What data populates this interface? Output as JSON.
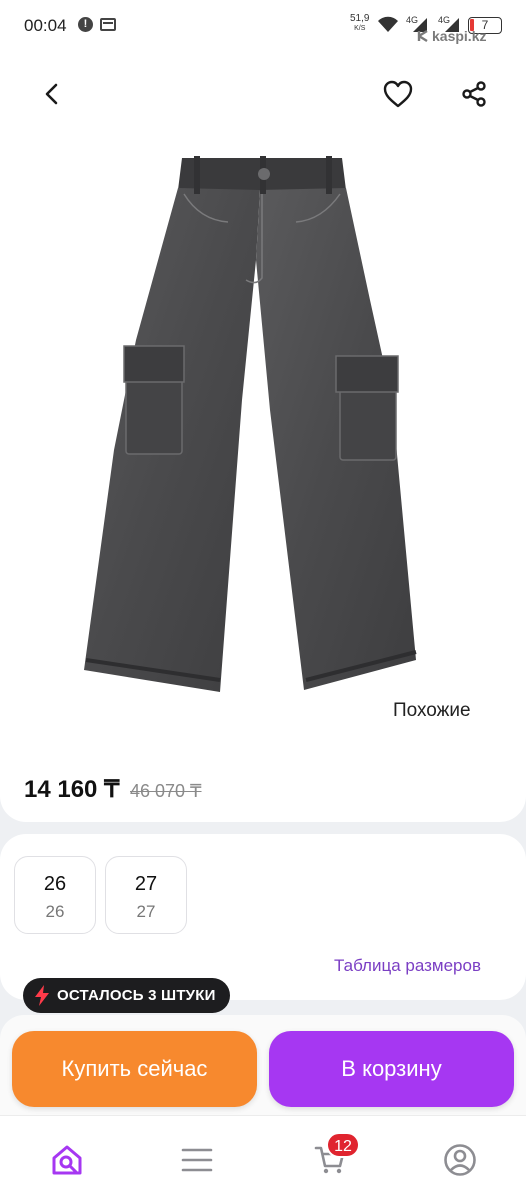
{
  "status_bar": {
    "time": "00:04",
    "speed_value": "51,9",
    "speed_unit": "K/S",
    "network_1": "4G",
    "network_2": "4G",
    "battery": "7",
    "watermark": "kaspi.kz"
  },
  "product": {
    "similar_label": "Похожие",
    "price_current": "14 160 ₸",
    "price_old": "46 070 ₸"
  },
  "sizes": [
    {
      "main": "26",
      "sub": "26"
    },
    {
      "main": "27",
      "sub": "27"
    }
  ],
  "size_table_label": "Таблица размеров",
  "stock_label": "ОСТАЛОСЬ 3 ШТУКИ",
  "actions": {
    "buy_now": "Купить сейчас",
    "to_cart": "В корзину"
  },
  "tabbar": {
    "cart_count": "12"
  },
  "colors": {
    "buy_now": "#f7892e",
    "to_cart": "#a637f2",
    "link": "#7b3fc4",
    "badge": "#e0242f"
  },
  "icons": [
    "back-arrow-icon",
    "heart-icon",
    "share-icon",
    "bolt-icon",
    "home-search-icon",
    "menu-icon",
    "cart-icon",
    "profile-icon"
  ]
}
